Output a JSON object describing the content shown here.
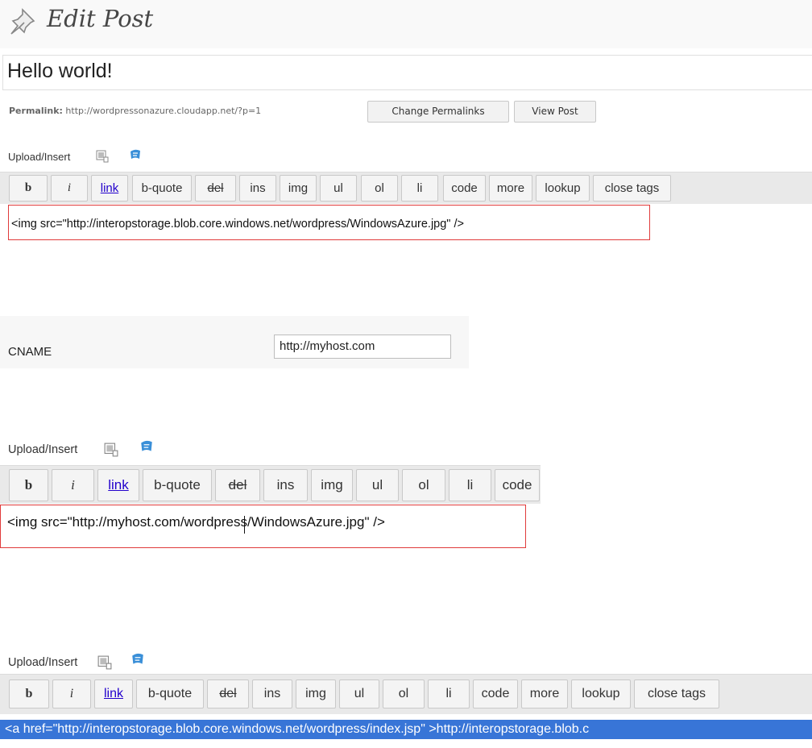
{
  "header": {
    "title": "Edit Post",
    "icon": "pin-icon"
  },
  "post": {
    "title": "Hello world!"
  },
  "permalink": {
    "label": "Permalink:",
    "url": "http://wordpressonazure.cloudapp.net/?p=1",
    "change_button": "Change Permalinks",
    "view_button": "View Post"
  },
  "upload_label": "Upload/Insert",
  "toolbar_buttons": [
    "b",
    "i",
    "link",
    "b-quote",
    "del",
    "ins",
    "img",
    "ul",
    "ol",
    "li",
    "code",
    "more",
    "lookup",
    "close tags"
  ],
  "editor1": {
    "content": "<img src=\"http://interopstorage.blob.core.windows.net/wordpress/WindowsAzure.jpg\" />"
  },
  "cname": {
    "label": "CNAME",
    "value": "http://myhost.com"
  },
  "editor2": {
    "content": "<img src=\"http://myhost.com/wordpress/WindowsAzure.jpg\" />"
  },
  "editor3": {
    "content": "<a href=\"http://interopstorage.blob.core.windows.net/wordpress/index.jsp\" >http://interopstorage.blob.c"
  },
  "colors": {
    "selection": "#3875d7",
    "highlight_border": "#e03b3b",
    "link": "#2200cc"
  }
}
